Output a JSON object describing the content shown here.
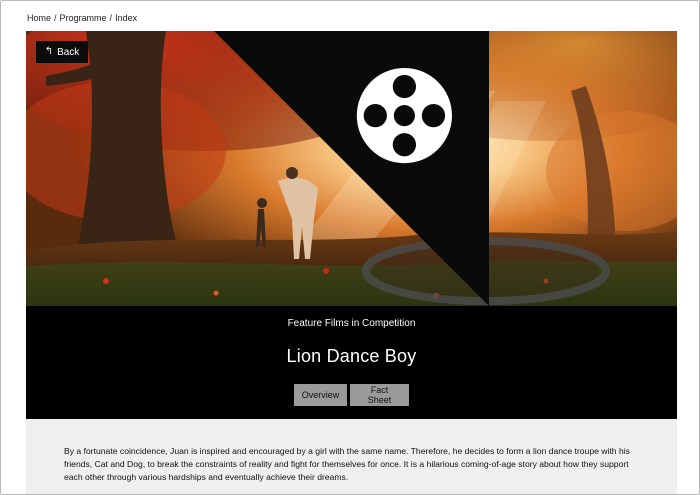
{
  "breadcrumb": {
    "items": [
      "Home",
      "Programme",
      "Index"
    ],
    "separator": "/"
  },
  "hero": {
    "back_label": "Back",
    "back_icon": "return-arrow-icon",
    "corner_icon": "film-reel-icon"
  },
  "film": {
    "category": "Feature Films in Competition",
    "title": "Lion Dance Boy",
    "tabs": [
      {
        "label": "Overview"
      },
      {
        "label": "Fact Sheet"
      }
    ],
    "description": "By a fortunate coincidence, Juan is inspired and encouraged by a girl with the same name. Therefore, he decides to form a lion dance troupe with his friends, Cat and Dog, to break the constraints of reality and fight for themselves for once. It is a hilarious coming-of-age story about how they support each other through various hardships and eventually achieve their dreams."
  },
  "colors": {
    "info_bg": "#000000",
    "tab_bg": "#9a9a9a",
    "desc_bg": "#efefef",
    "back_bg": "#0c0c0c"
  }
}
